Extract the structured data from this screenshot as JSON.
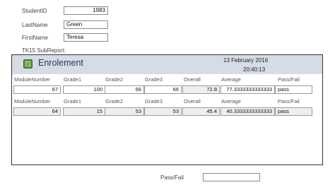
{
  "form": {
    "student_id_label": "StudentID",
    "student_id_value": "1983",
    "last_name_label": "LastName",
    "last_name_value": "Green",
    "first_name_label": "FirstName",
    "first_name_value": "Teresa",
    "subreport_label": "TK15 SubReport:",
    "pass_fail_label": "Pass/Fail",
    "pass_fail_value": ""
  },
  "subreport": {
    "title": "Enrolement",
    "date": "13 February 2016",
    "time": "20:40:13",
    "columns": [
      "ModuleNumber",
      "Grade1",
      "Grade2",
      "Grade3",
      "Overall",
      "Average",
      "Pass/Fail"
    ],
    "rows": [
      [
        "67",
        "100",
        "66",
        "66",
        "72.8",
        "77.3333333333333",
        "pass"
      ],
      [
        "64",
        "15",
        "53",
        "53",
        "45.4",
        "40.3333333333333",
        "pass"
      ]
    ]
  }
}
